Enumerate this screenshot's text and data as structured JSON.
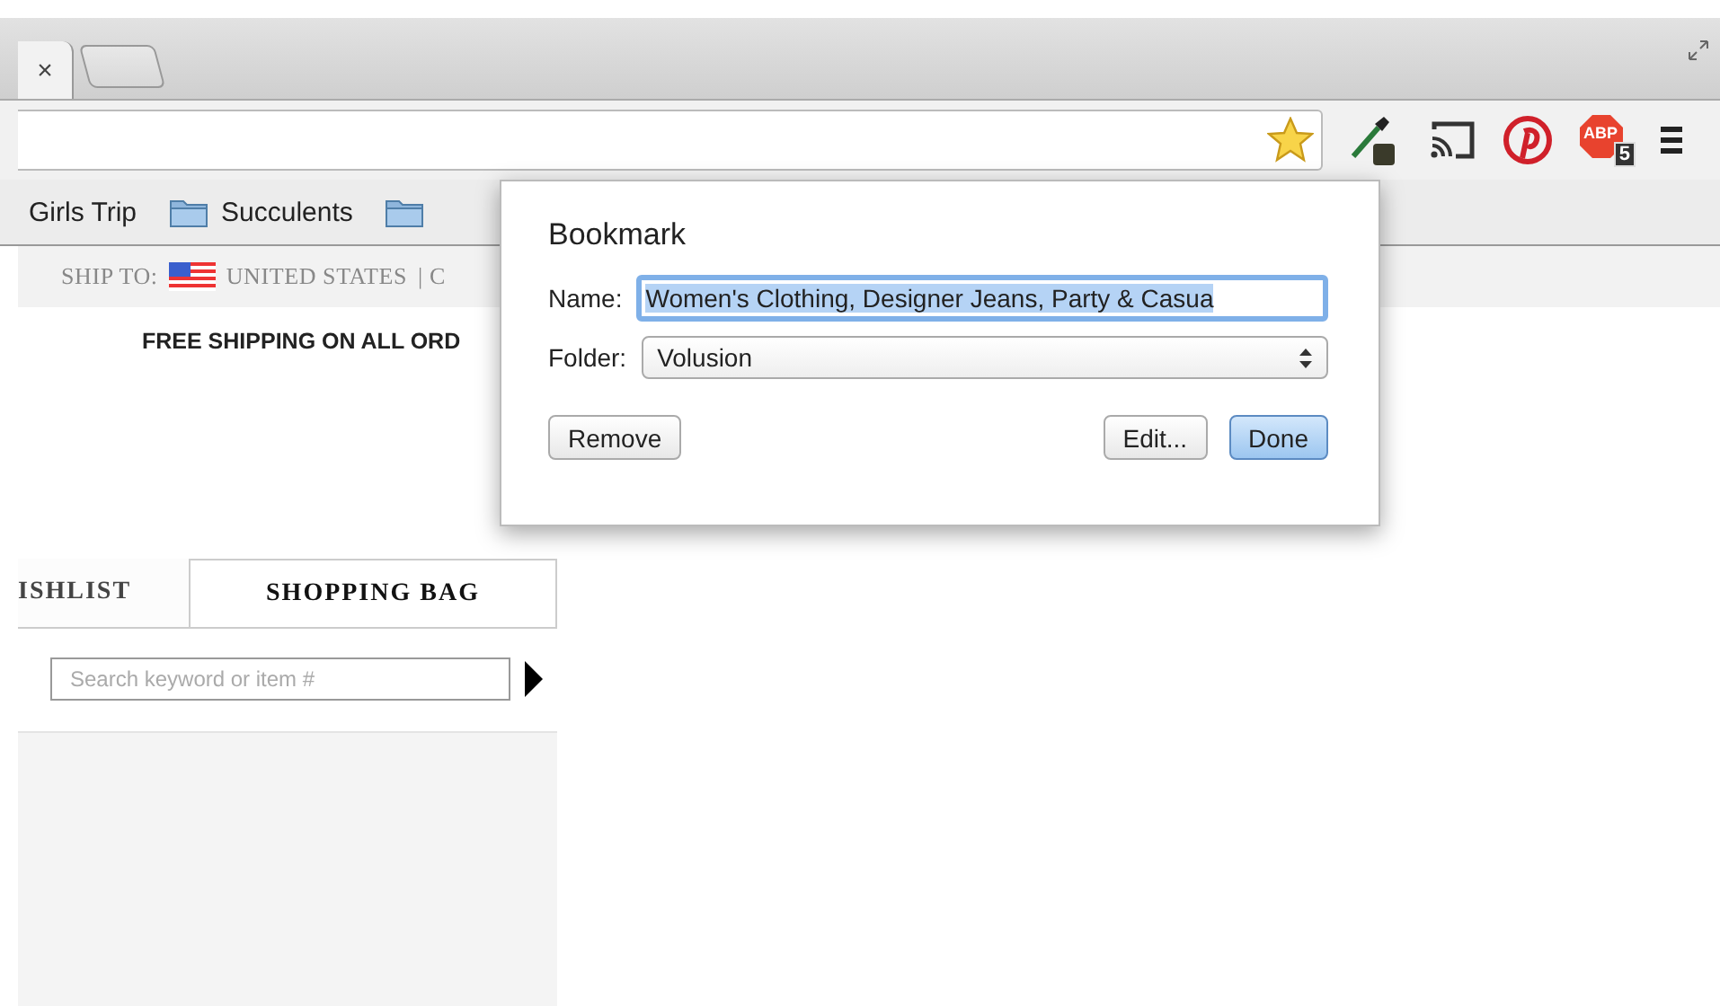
{
  "browser": {
    "tab": {
      "close_glyph": "×"
    },
    "omnibox": {
      "bookmarked": true
    },
    "extensions": [
      {
        "kind": "eyedropper"
      },
      {
        "kind": "cast"
      },
      {
        "kind": "pinterest"
      },
      {
        "kind": "adblock",
        "label": "ABP",
        "badge": "5"
      },
      {
        "kind": "menu"
      }
    ]
  },
  "bookmarks_bar": [
    {
      "label": "Girls Trip",
      "kind": "link"
    },
    {
      "label": "Succulents",
      "kind": "folder"
    },
    {
      "kind": "folder"
    }
  ],
  "page": {
    "ship_to": {
      "label": "SHIP TO:",
      "country": "UNITED STATES",
      "rest": "| C"
    },
    "announcement": "FREE SHIPPING ON ALL ORD",
    "account_tabs": [
      {
        "label": "ISHLIST",
        "selected": false
      },
      {
        "label": "SHOPPING BAG",
        "selected": true
      }
    ],
    "search": {
      "placeholder": "Search keyword or item #"
    }
  },
  "bookmark_popup": {
    "title": "Bookmark",
    "name_label": "Name:",
    "name_value": "Women's Clothing, Designer Jeans, Party & Casua",
    "name_selected": true,
    "folder_label": "Folder:",
    "folder_value": "Volusion",
    "left_buttons": [
      {
        "label": "Remove",
        "default": false
      }
    ],
    "right_buttons": [
      {
        "label": "Edit...",
        "default": false
      },
      {
        "label": "Done",
        "default": true
      }
    ]
  }
}
